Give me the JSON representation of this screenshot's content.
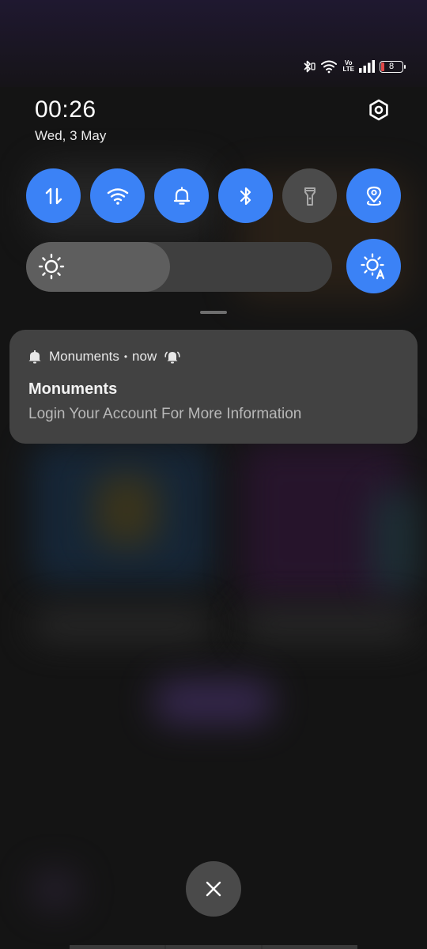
{
  "status_bar": {
    "icons": [
      "bluetooth-icon",
      "wifi-icon",
      "volte-icon",
      "signal-icon",
      "battery-icon"
    ],
    "volte_line1": "Vo",
    "volte_line2": "LTE",
    "battery_level": "8",
    "battery_color": "#e04848"
  },
  "header": {
    "time": "00:26",
    "date": "Wed, 3 May",
    "settings_icon": "settings-icon"
  },
  "quick_tiles": [
    {
      "name": "mobile-data",
      "icon": "data-arrows-icon",
      "active": true
    },
    {
      "name": "wifi",
      "icon": "wifi-icon",
      "active": true
    },
    {
      "name": "sound",
      "icon": "bell-icon",
      "active": true
    },
    {
      "name": "bluetooth",
      "icon": "bluetooth-icon",
      "active": true
    },
    {
      "name": "flashlight",
      "icon": "flashlight-icon",
      "active": false
    },
    {
      "name": "location",
      "icon": "location-icon",
      "active": true
    }
  ],
  "brightness": {
    "level": 0.47,
    "auto_icon": "auto-brightness-icon"
  },
  "notification": {
    "app_name": "Monuments",
    "separator": "•",
    "time": "now",
    "title": "Monuments",
    "body": "Login Your Account For More Information"
  },
  "colors": {
    "accent": "#3b82f6",
    "tile_off": "#4b4b4b",
    "card": "#424242"
  }
}
